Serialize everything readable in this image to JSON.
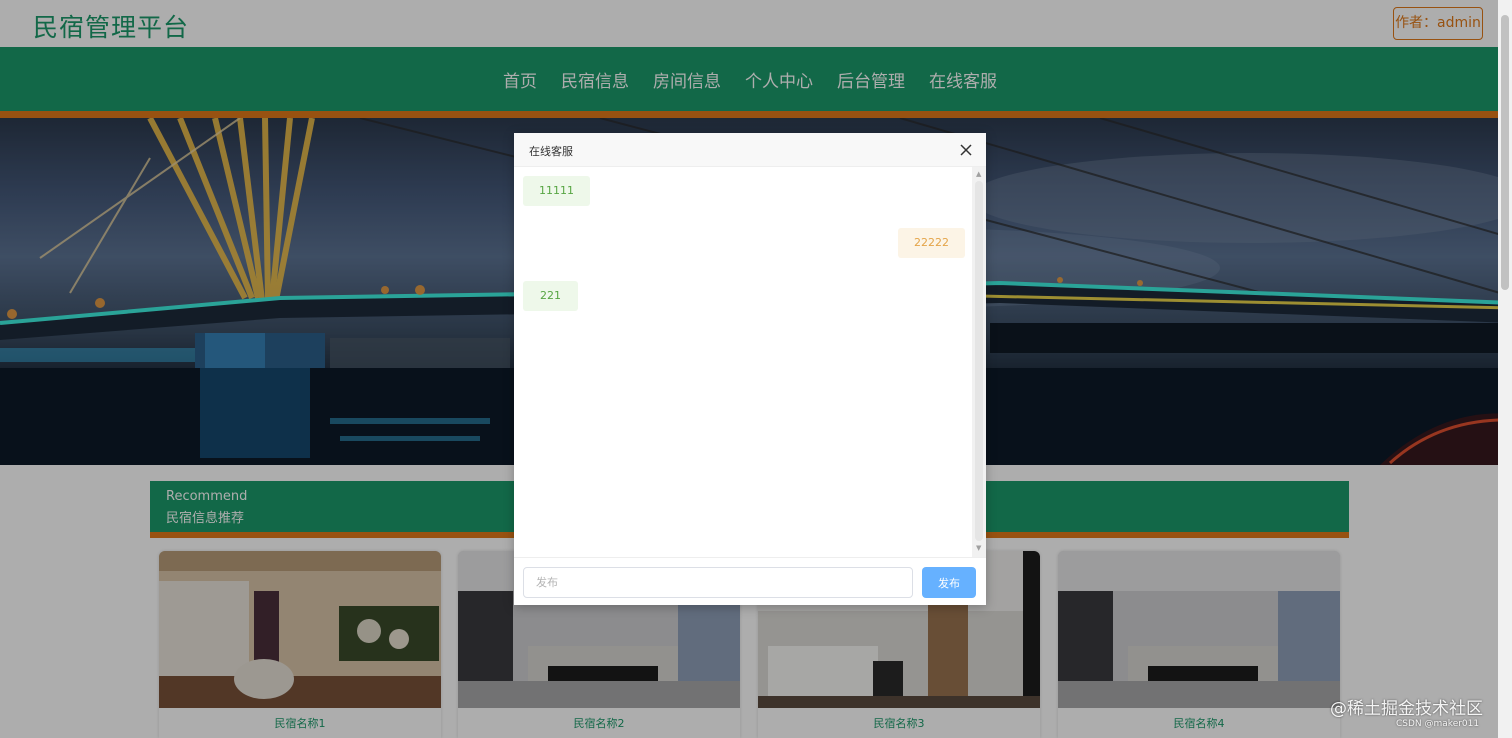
{
  "header": {
    "site_title": "民宿管理平台",
    "author_label": "作者：admin"
  },
  "nav": {
    "items": [
      {
        "label": "首页"
      },
      {
        "label": "民宿信息"
      },
      {
        "label": "房间信息"
      },
      {
        "label": "个人中心"
      },
      {
        "label": "后台管理"
      },
      {
        "label": "在线客服"
      }
    ]
  },
  "recommend": {
    "title_en": "Recommend",
    "title_cn": "民宿信息推荐",
    "cards": [
      {
        "name": "民宿名称1"
      },
      {
        "name": "民宿名称2"
      },
      {
        "name": "民宿名称3"
      },
      {
        "name": "民宿名称4"
      }
    ]
  },
  "dialog": {
    "title": "在线客服",
    "messages": [
      {
        "text": "11111",
        "side": "left"
      },
      {
        "text": "22222",
        "side": "right"
      },
      {
        "text": "221",
        "side": "left"
      }
    ],
    "input_placeholder": "发布",
    "input_value": "",
    "send_label": "发布"
  },
  "watermark": {
    "main": "@稀土掘金技术社区",
    "sub": "CSDN @maker011"
  },
  "colors": {
    "primary_green": "#1b9a6a",
    "accent_orange": "#e07a1a",
    "send_button": "#66b1ff",
    "msg_left_bg": "#eef8ea",
    "msg_right_bg": "#fcf4e6"
  }
}
